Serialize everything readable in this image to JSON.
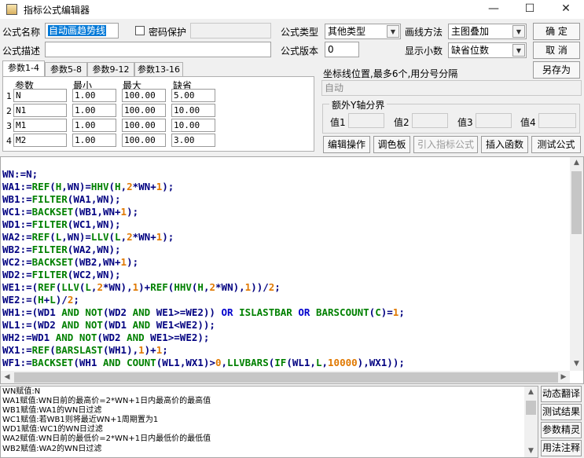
{
  "window": {
    "title": "指标公式编辑器",
    "minimize": "—",
    "maximize": "☐",
    "close": "✕"
  },
  "form": {
    "formula_name_label": "公式名称",
    "formula_name_value": "自动画趋势线",
    "password_label": "密码保护",
    "password_value": "",
    "formula_type_label": "公式类型",
    "formula_type_value": "其他类型",
    "draw_method_label": "画线方法",
    "draw_method_value": "主图叠加",
    "ok_label": "确    定",
    "formula_desc_label": "公式描述",
    "formula_desc_value": "",
    "formula_version_label": "公式版本",
    "formula_version_value": "0",
    "decimals_label": "显示小数",
    "decimals_value": "缺省位数",
    "cancel_label": "取    消",
    "save_as_label": "另存为"
  },
  "tabs": [
    {
      "label": "参数1-4"
    },
    {
      "label": "参数5-8"
    },
    {
      "label": "参数9-12"
    },
    {
      "label": "参数13-16"
    }
  ],
  "params": {
    "headers": {
      "name": "参数",
      "min": "最小",
      "max": "最大",
      "default": "缺省"
    },
    "rows": [
      {
        "no": "1",
        "name": "N",
        "min": "1.00",
        "max": "100.00",
        "default": "5.00"
      },
      {
        "no": "2",
        "name": "N1",
        "min": "1.00",
        "max": "100.00",
        "default": "10.00"
      },
      {
        "no": "3",
        "name": "M1",
        "min": "1.00",
        "max": "100.00",
        "default": "10.00"
      },
      {
        "no": "4",
        "name": "M2",
        "min": "1.00",
        "max": "100.00",
        "default": "3.00"
      }
    ]
  },
  "axis": {
    "position_label": "坐标线位置,最多6个,用分号分隔",
    "position_value": "自动",
    "y_group_label": "额外Y轴分界",
    "values": [
      {
        "label": "值1",
        "value": ""
      },
      {
        "label": "值2",
        "value": ""
      },
      {
        "label": "值3",
        "value": ""
      },
      {
        "label": "值4",
        "value": ""
      }
    ]
  },
  "actions": {
    "edit_ops": "编辑操作",
    "palette": "调色板",
    "import_formula": "引入指标公式",
    "insert_func": "插入函数",
    "test_formula": "测试公式"
  },
  "code_lines": [
    "WN:=N;",
    "WA1:=REF(H,WN)=HHV(H,2*WN+1);",
    "WB1:=FILTER(WA1,WN);",
    "WC1:=BACKSET(WB1,WN+1);",
    "WD1:=FILTER(WC1,WN);",
    "WA2:=REF(L,WN)=LLV(L,2*WN+1);",
    "WB2:=FILTER(WA2,WN);",
    "WC2:=BACKSET(WB2,WN+1);",
    "WD2:=FILTER(WC2,WN);",
    "WE1:=(REF(LLV(L,2*WN),1)+REF(HHV(H,2*WN),1))/2;",
    "WE2:=(H+L)/2;",
    "WH1:=(WD1 AND NOT(WD2 AND WE1>=WE2)) OR ISLASTBAR OR BARSCOUNT(C)=1;",
    "WL1:=(WD2 AND NOT(WD1 AND WE1<WE2));",
    "WH2:=WD1 AND NOT(WD2 AND WE1>=WE2);",
    "WX1:=REF(BARSLAST(WH1),1)+1;",
    "WF1:=BACKSET(WH1 AND COUNT(WL1,WX1)>0,LLVBARS(IF(WL1,L,10000),WX1));"
  ],
  "help_lines": [
    "WN赋值:N",
    "WA1赋值:WN日前的最高价=2*WN+1日内最高价的最高值",
    "WB1赋值:WA1的WN日过滤",
    "WC1赋值:若WB1则将最近WN+1周期置为1",
    "WD1赋值:WC1的WN日过滤",
    "WA2赋值:WN日前的最低价=2*WN+1日内最低价的最低值",
    "WB2赋值:WA2的WN日过滤"
  ],
  "side_buttons": {
    "dynamic_translate": "动态翻译",
    "test_result": "测试结果",
    "param_tips": "参数精灵",
    "usage_notes": "用法注释"
  },
  "colors": {
    "code_default": "#000080",
    "code_function": "#008000",
    "code_number": "#e07800",
    "code_logic": "#0000cc",
    "selection": "#0078d7"
  }
}
